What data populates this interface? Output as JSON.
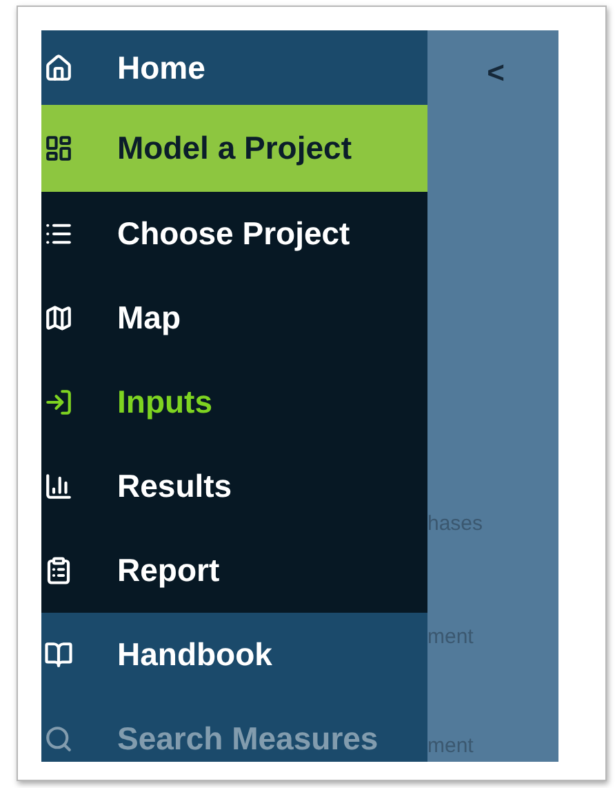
{
  "sidebar": {
    "sections": [
      {
        "dark": false,
        "items": [
          {
            "label": "Home",
            "selected": false,
            "highlighted": false,
            "disabled": false
          }
        ]
      },
      {
        "dark": true,
        "items": [
          {
            "label": "Model a Project",
            "selected": true,
            "highlighted": false,
            "disabled": false
          },
          {
            "label": "Choose Project",
            "selected": false,
            "highlighted": false,
            "disabled": false
          },
          {
            "label": "Map",
            "selected": false,
            "highlighted": false,
            "disabled": false
          },
          {
            "label": "Inputs",
            "selected": false,
            "highlighted": true,
            "disabled": false
          },
          {
            "label": "Results",
            "selected": false,
            "highlighted": false,
            "disabled": false
          },
          {
            "label": "Report",
            "selected": false,
            "highlighted": false,
            "disabled": false
          }
        ]
      },
      {
        "dark": false,
        "items": [
          {
            "label": "Handbook",
            "selected": false,
            "highlighted": false,
            "disabled": false
          },
          {
            "label": "Search Measures",
            "selected": false,
            "highlighted": false,
            "disabled": true
          }
        ]
      }
    ]
  },
  "panel": {
    "collapse": "<",
    "background_texts": [
      "hases",
      "ment",
      "ment"
    ]
  }
}
